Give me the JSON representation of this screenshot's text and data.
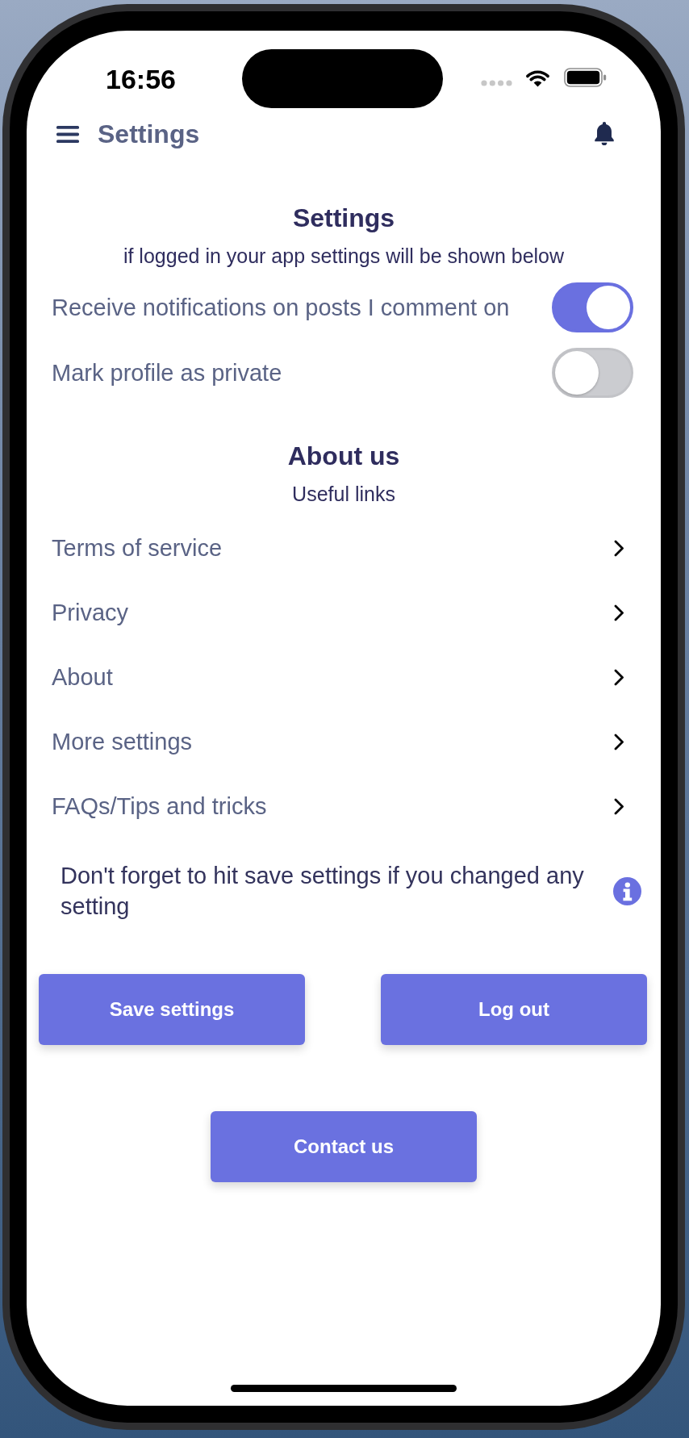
{
  "status_bar": {
    "time": "16:56"
  },
  "header": {
    "title": "Settings"
  },
  "settings": {
    "title": "Settings",
    "subtitle": "if logged in your app settings will be shown below",
    "toggles": [
      {
        "label": "Receive notifications on posts I comment on",
        "on": true
      },
      {
        "label": "Mark profile as private",
        "on": false
      }
    ]
  },
  "about": {
    "title": "About us",
    "subtitle": "Useful links",
    "links": [
      {
        "label": "Terms of service"
      },
      {
        "label": "Privacy"
      },
      {
        "label": "About"
      },
      {
        "label": "More settings"
      },
      {
        "label": "FAQs/Tips and tricks"
      }
    ]
  },
  "notice": {
    "text": "Don't forget to hit save settings if you changed any setting"
  },
  "buttons": [
    {
      "label": "Save settings"
    },
    {
      "label": "Log out"
    }
  ],
  "contact_button": {
    "label": "Contact us"
  }
}
